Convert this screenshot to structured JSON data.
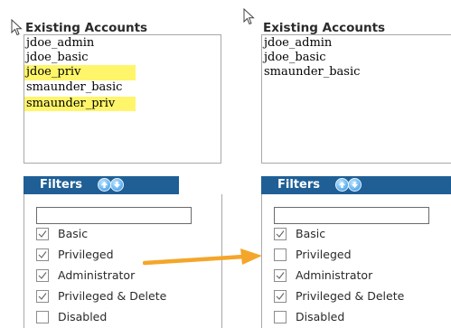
{
  "left_panel": {
    "accounts_title": "Existing Accounts",
    "accounts": [
      {
        "name": "jdoe_admin",
        "highlighted": false
      },
      {
        "name": "jdoe_basic",
        "highlighted": false
      },
      {
        "name": "jdoe_priv",
        "highlighted": true
      },
      {
        "name": "smaunder_basic",
        "highlighted": false
      },
      {
        "name": "smaunder_priv",
        "highlighted": true
      }
    ],
    "filters_title": "Filters",
    "filter_search_value": "",
    "filters": [
      {
        "label": "Basic",
        "checked": true
      },
      {
        "label": "Privileged",
        "checked": true
      },
      {
        "label": "Administrator",
        "checked": true
      },
      {
        "label": "Privileged & Delete",
        "checked": true
      },
      {
        "label": "Disabled",
        "checked": false
      }
    ]
  },
  "right_panel": {
    "accounts_title": "Existing Accounts",
    "accounts": [
      {
        "name": "jdoe_admin",
        "highlighted": false
      },
      {
        "name": "jdoe_basic",
        "highlighted": false
      },
      {
        "name": "smaunder_basic",
        "highlighted": false
      }
    ],
    "filters_title": "Filters",
    "filter_search_value": "",
    "filters": [
      {
        "label": "Basic",
        "checked": true
      },
      {
        "label": "Privileged",
        "checked": false
      },
      {
        "label": "Administrator",
        "checked": true
      },
      {
        "label": "Privileged & Delete",
        "checked": true
      },
      {
        "label": "Disabled",
        "checked": false
      }
    ]
  },
  "colors": {
    "filters_header_bg": "#1f5f96",
    "highlight": "#fff56a",
    "annotation_arrow": "#f4a62a"
  },
  "icons": {
    "sort_up": "arrow-up-circle-icon",
    "sort_down": "arrow-down-circle-icon",
    "cursor": "mouse-pointer-icon",
    "annotation": "orange-arrow-icon"
  }
}
